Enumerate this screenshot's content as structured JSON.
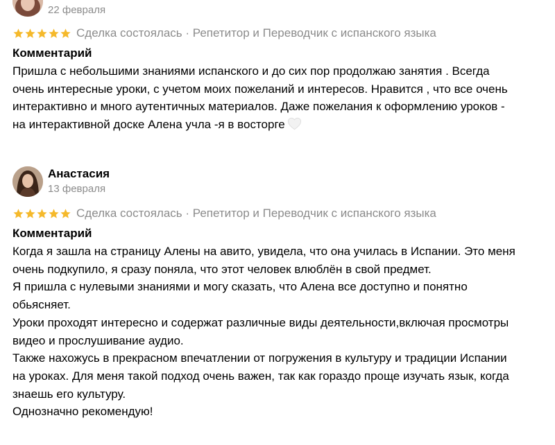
{
  "reviews": [
    {
      "author": "",
      "date": "22 февраля",
      "rating": 5,
      "deal": "Сделка состоялась · Репетитор и Переводчик с испанского языка",
      "comment_title": "Комментарий",
      "lines": [
        "Пришла с небольшими знаниями испанского и до сих пор продолжаю занятия . Всегда",
        "очень интересные уроки, с учетом моих пожеланий и интересов. Нравится , что все очень",
        "интерактивно и много аутентичных материалов. Даже пожелания к оформлению уроков -",
        "на интерактивной доске Алена учла -я в восторге"
      ],
      "trailing_icon": "white-heart-icon"
    },
    {
      "author": "Анастасия",
      "date": "13 февраля",
      "rating": 5,
      "deal": "Сделка состоялась · Репетитор и Переводчик с испанского языка",
      "comment_title": "Комментарий",
      "lines": [
        "Когда я зашла на страницу Алены на авито, увидела, что она училась в Испании. Это меня",
        "очень подкупило, я сразу поняла, что этот человек влюблён в свой предмет.",
        "Я пришла с нулевыми знаниями и могу сказать, что Алена все доступно и понятно",
        "обьясняет.",
        "Уроки проходят интересно и содержат различные виды деятельности,включая просмотры",
        "видео и прослушивание аудио.",
        "Также нахожусь в прекрасном впечатлении от погружения в культуру и традиции Испании",
        "на уроках. Для меня такой подход очень важен, так как гораздо проще изучать язык, когда",
        "знаешь его культуру.",
        "Однозначно рекомендую!"
      ]
    }
  ],
  "colors": {
    "star": "#f5b92b",
    "muted_text": "#8b8b8b",
    "text": "#000000",
    "background": "#ffffff"
  }
}
